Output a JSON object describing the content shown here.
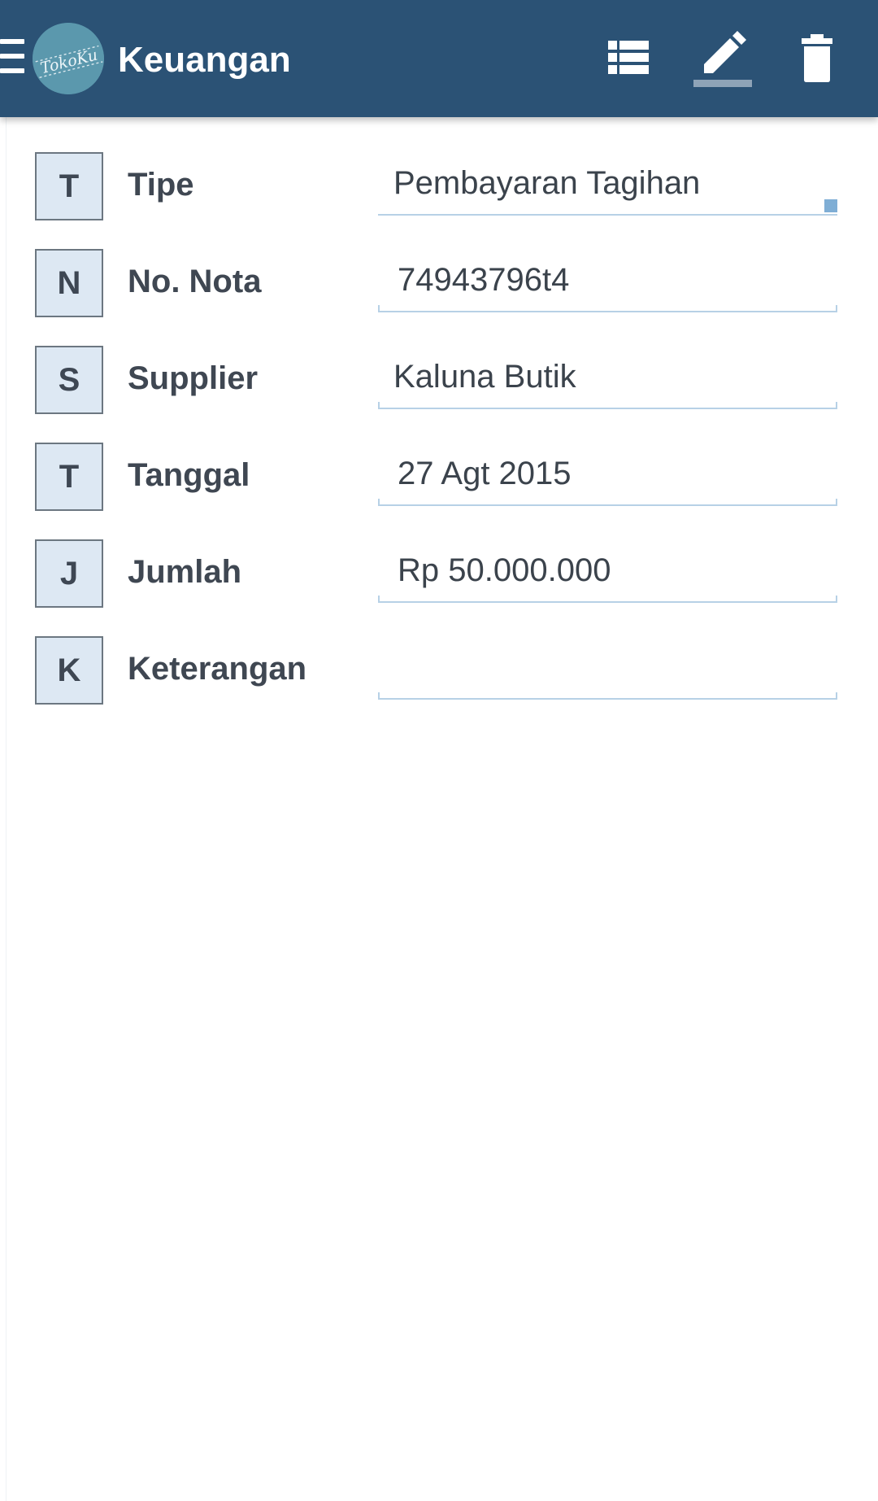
{
  "app": {
    "title": "Keuangan",
    "logo_text": "TokoKu"
  },
  "toolbar": {
    "menu_icon": "hamburger-menu-icon",
    "list_icon": "list-icon",
    "edit_icon": "pencil-icon",
    "delete_icon": "trash-icon"
  },
  "colors": {
    "appbar": "#2b5275",
    "logo": "#5b98ad",
    "initial_bg": "#dde8f3",
    "field_underline": "#b7d1e6",
    "dropdown_marker": "#7faed5"
  },
  "form": {
    "fields": [
      {
        "initial": "T",
        "label": "Tipe",
        "value": "Pembayaran Tagihan"
      },
      {
        "initial": "N",
        "label": "No. Nota",
        "value": "74943796t4"
      },
      {
        "initial": "S",
        "label": "Supplier",
        "value": "Kaluna Butik"
      },
      {
        "initial": "T",
        "label": "Tanggal",
        "value": "27 Agt 2015"
      },
      {
        "initial": "J",
        "label": "Jumlah",
        "value": "Rp 50.000.000"
      },
      {
        "initial": "K",
        "label": "Keterangan",
        "value": ""
      }
    ]
  }
}
